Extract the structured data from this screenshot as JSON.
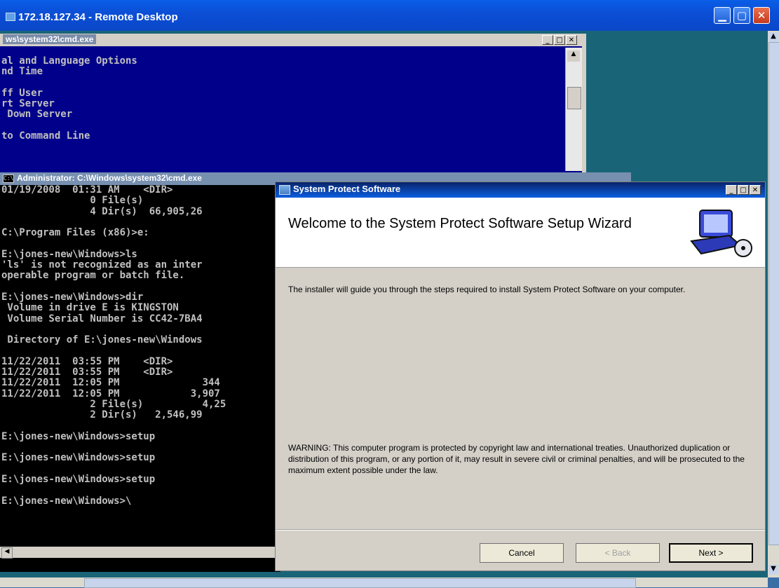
{
  "remote_desktop": {
    "title": "172.18.127.34 - Remote Desktop"
  },
  "cmd_back": {
    "title": "ws\\system32\\cmd.exe",
    "lines": [
      "al and Language Options",
      "nd Time",
      "",
      "ff User",
      "rt Server",
      " Down Server",
      "",
      "to Command Line"
    ]
  },
  "cmd_front": {
    "title": "Administrator: C:\\Windows\\system32\\cmd.exe",
    "lines": [
      "01/19/2008  01:31 AM    <DIR>",
      "               0 File(s)",
      "               4 Dir(s)  66,905,26",
      "",
      "C:\\Program Files (x86)>e:",
      "",
      "E:\\jones-new\\Windows>ls",
      "'ls' is not recognized as an inter",
      "operable program or batch file.",
      "",
      "E:\\jones-new\\Windows>dir",
      " Volume in drive E is KINGSTON",
      " Volume Serial Number is CC42-7BA4",
      "",
      " Directory of E:\\jones-new\\Windows",
      "",
      "11/22/2011  03:55 PM    <DIR>",
      "11/22/2011  03:55 PM    <DIR>",
      "11/22/2011  12:05 PM              344",
      "11/22/2011  12:05 PM            3,907",
      "               2 File(s)          4,25",
      "               2 Dir(s)   2,546,99",
      "",
      "E:\\jones-new\\Windows>setup",
      "",
      "E:\\jones-new\\Windows>setup",
      "",
      "E:\\jones-new\\Windows>setup",
      "",
      "E:\\jones-new\\Windows>\\"
    ]
  },
  "installer": {
    "title": "System Protect Software",
    "headline": "Welcome to the System Protect Software Setup Wizard",
    "intro": "The installer will guide you through the steps required to install System Protect Software on your computer.",
    "warning": "WARNING: This computer program is protected by copyright law and international treaties. Unauthorized duplication or distribution of this program, or any portion of it, may result in severe civil or criminal penalties, and will be prosecuted to the maximum extent possible under the law.",
    "cancel_label": "Cancel",
    "back_label": "< Back",
    "next_label": "Next >"
  },
  "colors": {
    "titlebar": "#0b4fd6",
    "desktop": "#1a6478",
    "cmd_bg": "#00008a",
    "dialog": "#d4d0c8"
  }
}
